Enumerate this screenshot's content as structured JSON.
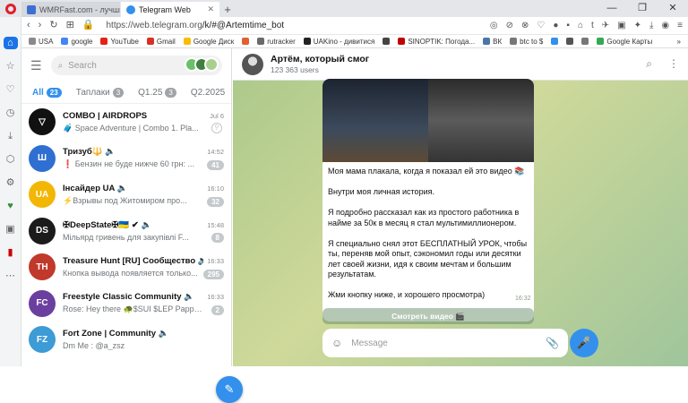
{
  "browser": {
    "tabs": [
      {
        "title": "WMRFast.com - лучшие с",
        "active": false
      },
      {
        "title": "Telegram Web",
        "active": true
      }
    ],
    "new_tab": "+",
    "win": {
      "min": "—",
      "max": "❐",
      "close": "✕"
    },
    "url_host": "https://web.telegram.org",
    "url_path": "/k/#@Artemtime_bot",
    "bookmarks": [
      {
        "label": "USA",
        "color": "#8a8a8a"
      },
      {
        "label": "google",
        "color": "#4285f4"
      },
      {
        "label": "YouTube",
        "color": "#e62117"
      },
      {
        "label": "Gmail",
        "color": "#d93025"
      },
      {
        "label": "Google Диск",
        "color": "#fbbc04"
      },
      {
        "label": "",
        "color": "#e06030"
      },
      {
        "label": "rutracker",
        "color": "#6a6a6a"
      },
      {
        "label": "UAKino - дивитися",
        "color": "#222222"
      },
      {
        "label": "",
        "color": "#444444"
      },
      {
        "label": "SINOPTIK: Погода...",
        "color": "#c00000"
      },
      {
        "label": "ВК",
        "color": "#4a76a8"
      },
      {
        "label": "btc to $",
        "color": "#777777"
      },
      {
        "label": "",
        "color": "#3390ec"
      },
      {
        "label": "",
        "color": "#555555"
      },
      {
        "label": "",
        "color": "#777777"
      },
      {
        "label": "Google Карты",
        "color": "#34a853"
      }
    ],
    "bookmarks_more": "»"
  },
  "telegram": {
    "search_placeholder": "Search",
    "folders": [
      {
        "label": "All",
        "count": "23",
        "active": true
      },
      {
        "label": "Таплаки",
        "count": "3",
        "active": false
      },
      {
        "label": "Q1.25",
        "count": "3",
        "active": false
      },
      {
        "label": "Q2.2025",
        "count": "",
        "active": false
      }
    ],
    "chats": [
      {
        "name": "COMBO | AIRDROPS",
        "time": "Jul 6",
        "preview": "🧳 Space Adventure | Combo 1. Pla...",
        "badge": "",
        "pinned": true,
        "avatar_color": "#111111",
        "avatar_text": "▽"
      },
      {
        "name": "Тризуб🔱 🔈",
        "time": "14:52",
        "preview": "❗ Бензин не буде нижче 60 грн: ...",
        "badge": "41",
        "pinned": false,
        "avatar_color": "#2f6fd1",
        "avatar_text": "Ш"
      },
      {
        "name": "Інсайдер UA 🔈",
        "time": "16:10",
        "preview": "⚡Взрывы под Житомиром про...",
        "badge": "32",
        "pinned": false,
        "avatar_color": "#f2b705",
        "avatar_text": "UA"
      },
      {
        "name": "✠DeepState✠🇺🇦 ✔ 🔈",
        "time": "15:48",
        "preview": "Мільярд гривень для закупівлі F...",
        "badge": "8",
        "pinned": false,
        "avatar_color": "#1b1b1b",
        "avatar_text": "DS"
      },
      {
        "name": "Treasure Hunt [RU] Сообщество 🔈",
        "time": "16:33",
        "preview": "Кнопка вывода появляется только...",
        "badge": "295",
        "pinned": false,
        "avatar_color": "#c0392b",
        "avatar_text": "TH"
      },
      {
        "name": "Freestyle Classic Community 🔈",
        "time": "16:33",
        "preview": "Rose: Hey there 🐢$SUI $LEP PappuGr...",
        "badge": "2",
        "pinned": false,
        "avatar_color": "#6b3fa0",
        "avatar_text": "FC"
      },
      {
        "name": "Fort Zone | Community 🔈",
        "time": "",
        "preview": "Dm Me : @a_zsz",
        "badge": "",
        "pinned": false,
        "avatar_color": "#3d9bd6",
        "avatar_text": "FZ"
      }
    ],
    "channel": {
      "title": "Артём, который смог",
      "subtitle": "123 363 users"
    },
    "message": {
      "paragraphs": [
        "Моя мама плакала, когда я показал ей это видео 📚",
        "Внутри моя личная история.",
        "Я подробно рассказал как из простого работника в найме за 50к в месяц я стал мультимиллионером.",
        "Я специально снял этот БЕСПЛАТНЫЙ УРОК, чтобы ты, переняв мой опыт, сэкономил годы или десятки лет своей жизни, идя к своим мечтам и большим результатам.",
        "Жми кнопку ниже, и хорошего просмотра)"
      ],
      "time": "16:32",
      "button": "Смотреть видео 🎬"
    },
    "composer_placeholder": "Message"
  }
}
